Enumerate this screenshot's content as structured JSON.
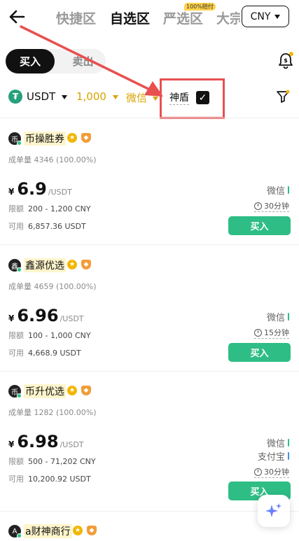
{
  "header": {
    "tabs": [
      "快捷区",
      "自选区",
      "严选区",
      "大宗"
    ],
    "active_tab_index": 1,
    "badge": "100%赔付",
    "currency": "CNY"
  },
  "trade_toggle": {
    "buy": "买入",
    "sell": "卖出"
  },
  "filters": {
    "coin": "USDT",
    "amount": "1,000",
    "payment": "微信",
    "shield_label": "神盾",
    "shield_checked": true
  },
  "colors": {
    "buy_green": "#2ebd85",
    "accent_gold": "#d9a300",
    "highlight_red": "#e8504f",
    "tether_green": "#26a17b"
  },
  "offers": [
    {
      "avatar": "币",
      "merchant": "币操胜券",
      "orders_label": "成单量",
      "orders": "4346 (100.00%)",
      "currency_symbol": "¥",
      "price": "6.9",
      "unit": "/USDT",
      "limit_label": "限额",
      "limit": "200 - 1,200 CNY",
      "available_label": "可用",
      "available": "6,857.36 USDT",
      "payments": [
        {
          "name": "微信",
          "color": "#2ebd85"
        }
      ],
      "time": "30分钟",
      "button": "买入"
    },
    {
      "avatar": "鑫",
      "merchant": "鑫源优选",
      "orders_label": "成单量",
      "orders": "4659 (100.00%)",
      "currency_symbol": "¥",
      "price": "6.96",
      "unit": "/USDT",
      "limit_label": "限额",
      "limit": "100 - 1,000 CNY",
      "available_label": "可用",
      "available": "4,668.9 USDT",
      "payments": [
        {
          "name": "微信",
          "color": "#2ebd85"
        }
      ],
      "time": "15分钟",
      "button": "买入"
    },
    {
      "avatar": "币",
      "merchant": "币升优选",
      "orders_label": "成单量",
      "orders": "1282 (100.00%)",
      "currency_symbol": "¥",
      "price": "6.98",
      "unit": "/USDT",
      "limit_label": "限额",
      "limit": "500 - 71,202 CNY",
      "available_label": "可用",
      "available": "10,200.92 USDT",
      "payments": [
        {
          "name": "微信",
          "color": "#2ebd85"
        },
        {
          "name": "支付宝",
          "color": "#3f8ef0"
        }
      ],
      "time": "30分钟",
      "button": "买入"
    },
    {
      "avatar": "A",
      "merchant": "a财神商行"
    }
  ]
}
